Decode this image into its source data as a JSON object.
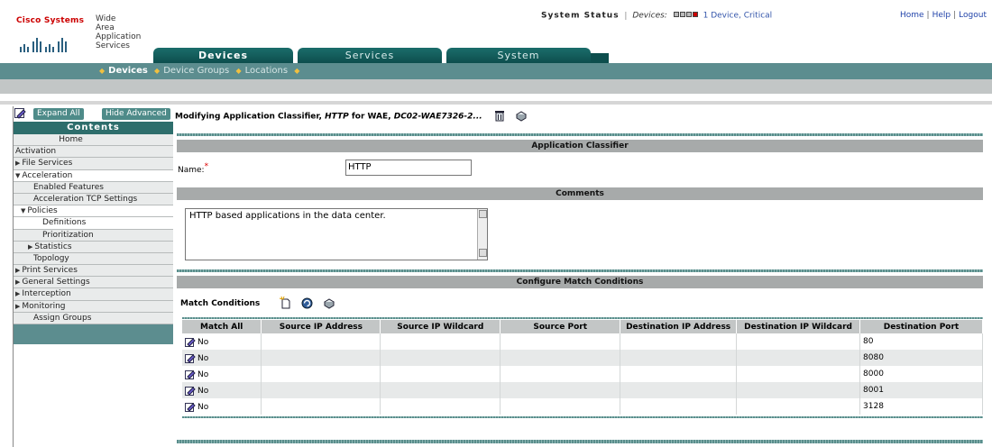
{
  "header": {
    "logo_text": "Cisco Systems",
    "app_name_lines": [
      "Wide",
      "Area",
      "Application",
      "Services"
    ],
    "status_title": "System Status",
    "status_sep": "|",
    "status_devices_label": "Devices:",
    "status_link": "1 Device, Critical",
    "top_links": [
      "Home",
      "Help",
      "Logout"
    ]
  },
  "tabs": [
    {
      "label": "Devices",
      "active": true
    },
    {
      "label": "Services",
      "active": false
    },
    {
      "label": "System",
      "active": false
    }
  ],
  "subnav": [
    "Devices",
    "Device Groups",
    "Locations"
  ],
  "sidebar": {
    "expand_all": "Expand All",
    "hide_advanced": "Hide Advanced",
    "contents": "Contents",
    "items": [
      {
        "label": "Home",
        "level": "l0c"
      },
      {
        "label": "Activation",
        "level": "l0"
      },
      {
        "label": "File Services",
        "level": "l0",
        "arrow": "right"
      },
      {
        "label": "Acceleration",
        "level": "l0",
        "arrow": "down",
        "white": true
      },
      {
        "label": "Enabled Features",
        "level": "l1"
      },
      {
        "label": "Acceleration TCP Settings",
        "level": "l1"
      },
      {
        "label": "Policies",
        "level": "l1b",
        "arrow": "down",
        "white": true
      },
      {
        "label": "Definitions",
        "level": "l2",
        "white": true
      },
      {
        "label": "Prioritization",
        "level": "l2"
      },
      {
        "label": "Statistics",
        "level": "l2b",
        "arrow": "right"
      },
      {
        "label": "Topology",
        "level": "l1"
      },
      {
        "label": "Print Services",
        "level": "l0",
        "arrow": "right"
      },
      {
        "label": "General Settings",
        "level": "l0",
        "arrow": "right"
      },
      {
        "label": "Interception",
        "level": "l0",
        "arrow": "right"
      },
      {
        "label": "Monitoring",
        "level": "l0",
        "arrow": "right"
      },
      {
        "label": "Assign Groups",
        "level": "l1"
      }
    ]
  },
  "main": {
    "title_prefix": "Modifying Application Classifier,",
    "title_name": "HTTP",
    "title_mid": "for WAE,",
    "title_device": "DC02-WAE7326-2...",
    "section_app": "Application Classifier",
    "name_label": "Name:",
    "required_mark": "*",
    "name_value": "HTTP",
    "section_comments": "Comments",
    "comments_value": "HTTP based applications in the data center.",
    "section_match": "Configure Match Conditions",
    "match_conditions_label": "Match Conditions",
    "table": {
      "columns": [
        "Match All",
        "Source IP Address",
        "Source IP Wildcard",
        "Source Port",
        "Destination IP Address",
        "Destination IP Wildcard",
        "Destination Port"
      ],
      "rows": [
        [
          "No",
          "",
          "",
          "",
          "",
          "",
          "80"
        ],
        [
          "No",
          "",
          "",
          "",
          "",
          "",
          "8080"
        ],
        [
          "No",
          "",
          "",
          "",
          "",
          "",
          "8000"
        ],
        [
          "No",
          "",
          "",
          "",
          "",
          "",
          "8001"
        ],
        [
          "No",
          "",
          "",
          "",
          "",
          "",
          "3128"
        ]
      ]
    }
  },
  "colors": {
    "teal_dark": "#0d4e4d",
    "teal_mid": "#5c8d8f",
    "critical": "#cc0000",
    "link": "#3355aa"
  }
}
